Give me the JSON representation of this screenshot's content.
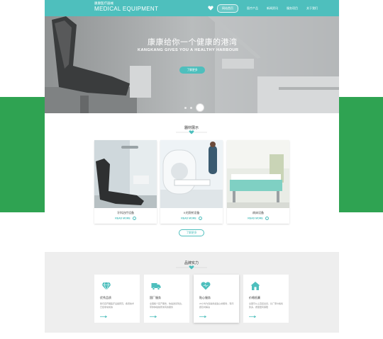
{
  "colors": {
    "accent": "#4ebfbd",
    "background_band": "#2fa352",
    "section_gray": "#eeeeee"
  },
  "header": {
    "logo_small": "康康医疗器械",
    "logo_big": "MEDICAL EQUIPMENT",
    "nav": [
      {
        "label": "网站首页",
        "active": true,
        "icon": "heart-icon"
      },
      {
        "label": "医疗产品"
      },
      {
        "label": "新闻资讯"
      },
      {
        "label": "服务项目"
      },
      {
        "label": "关于我们"
      }
    ]
  },
  "hero": {
    "title": "康康给你一个健康的港湾",
    "subtitle": "KANGKANG GIVES YOU A HEALTHY HARBOUR",
    "button": "了解更多",
    "slide_count": 3,
    "active_slide": 3
  },
  "products": {
    "title": "器材展示",
    "items": [
      {
        "name": "牙科治疗设备",
        "more": "READ MORE"
      },
      {
        "name": "X光照射设备",
        "more": "READ MORE"
      },
      {
        "name": "病床设备",
        "more": "READ MORE"
      }
    ],
    "more_button": "了解更多"
  },
  "strength": {
    "title": "品牌实力",
    "items": [
      {
        "name": "优秀品质",
        "icon": "diamond-icon",
        "desc": "我们自开展医疗设备研究，各项技术已经非常成熟"
      },
      {
        "name": "国厂服务",
        "icon": "truck-icon",
        "desc": "全国各个区产服务，快速送货到达，带你体验前所未有的服务"
      },
      {
        "name": "贴心服务",
        "icon": "heart-icon",
        "desc": "24小时为您提供最贴心的服务，有问题及时解决"
      },
      {
        "name": "价格低廉",
        "icon": "house-icon",
        "desc": "全国可以上直接出货，比厂家价格优势多，质量更有保障"
      }
    ]
  }
}
